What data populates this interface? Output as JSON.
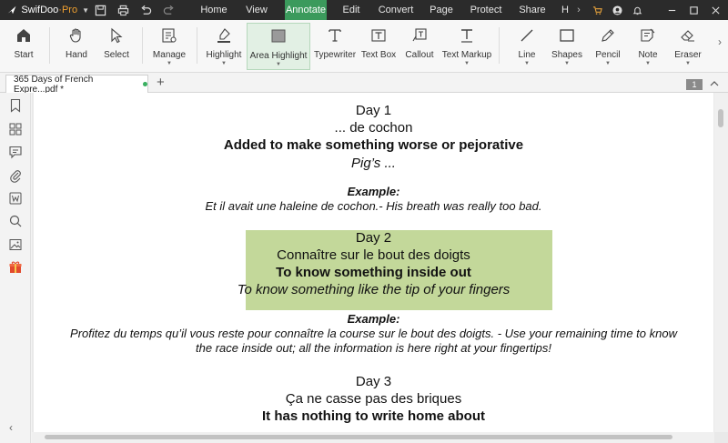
{
  "app": {
    "brand": "SwifDoo",
    "edition": "·Pro"
  },
  "menu": {
    "items": [
      "Home",
      "View",
      "Annotate",
      "Edit",
      "Convert",
      "Page",
      "Protect",
      "Share",
      "H"
    ],
    "active": "Annotate"
  },
  "ribbon": {
    "tools": [
      {
        "label": "Start",
        "icon": "home-icon"
      },
      {
        "label": "Hand",
        "icon": "hand-icon"
      },
      {
        "label": "Select",
        "icon": "cursor-icon"
      },
      {
        "label": "Manage",
        "icon": "manage-icon",
        "dropdown": true
      },
      {
        "label": "Highlight",
        "icon": "highlighter-icon",
        "dropdown": true
      },
      {
        "label": "Area Highlight",
        "icon": "area-highlight-icon",
        "dropdown": true,
        "active": true
      },
      {
        "label": "Typewriter",
        "icon": "typewriter-icon"
      },
      {
        "label": "Text Box",
        "icon": "text-box-icon"
      },
      {
        "label": "Callout",
        "icon": "callout-icon"
      },
      {
        "label": "Text Markup",
        "icon": "text-markup-icon",
        "dropdown": true
      },
      {
        "label": "Line",
        "icon": "line-icon",
        "dropdown": true
      },
      {
        "label": "Shapes",
        "icon": "shapes-icon",
        "dropdown": true
      },
      {
        "label": "Pencil",
        "icon": "pencil-icon",
        "dropdown": true
      },
      {
        "label": "Note",
        "icon": "note-icon",
        "dropdown": true
      },
      {
        "label": "Eraser",
        "icon": "eraser-icon",
        "dropdown": true
      }
    ]
  },
  "tabs": {
    "document_tab": "365 Days of French Expre...pdf *",
    "add": "+",
    "page_number": "1"
  },
  "document": {
    "day1": {
      "day": "Day 1",
      "phrase": "... de cochon",
      "meaning": "Added to make something worse or pejorative",
      "translation": "Pig’s ...",
      "example_label": "Example:",
      "example": "Et il avait une haleine de cochon.- His breath was really too bad."
    },
    "day2": {
      "day": "Day 2",
      "phrase": "Connaître sur le bout des doigts",
      "meaning": "To know something inside out",
      "translation": "To know something like the tip of your fingers",
      "example_label": "Example:",
      "example_line1": "Profitez du temps qu’il vous reste pour connaître la course sur le bout des doigts. - Use your remaining time to know",
      "example_line2": "the race inside out; all the information is here right at your fingertips!",
      "highlight_color": "#c3d89a"
    },
    "day3": {
      "day": "Day 3",
      "phrase": "Ça ne casse pas des briques",
      "meaning": "It has nothing to write home about"
    }
  },
  "colors": {
    "accent": "#3b9a5c",
    "titlebar": "#2b2b2b"
  }
}
